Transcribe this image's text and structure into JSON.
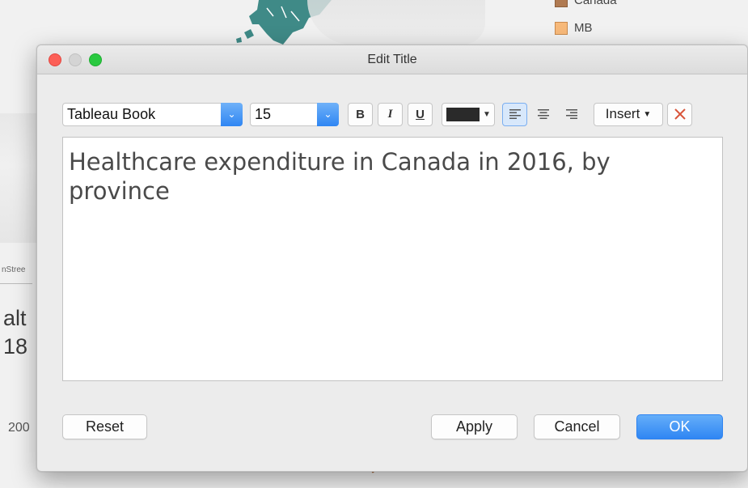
{
  "background": {
    "legend": [
      {
        "label": "Canada"
      },
      {
        "label": "MB"
      }
    ],
    "side_text_small": "nStree",
    "side_text_line1": "alt",
    "side_text_line2": "18",
    "axis_label": "200"
  },
  "dialog": {
    "title": "Edit Title",
    "toolbar": {
      "font_family": "Tableau Book",
      "font_size": "15",
      "bold_label": "B",
      "italic_label": "I",
      "underline_label": "U",
      "text_color": "#2a2a2a",
      "insert_label": "Insert"
    },
    "editor_text": "Healthcare expenditure in Canada in 2016, by province",
    "buttons": {
      "reset": "Reset",
      "apply": "Apply",
      "cancel": "Cancel",
      "ok": "OK"
    }
  },
  "colors": {
    "accent": "#2f86f3",
    "map_teal": "#3f8a87",
    "legend_fill": "#f7b97a"
  }
}
